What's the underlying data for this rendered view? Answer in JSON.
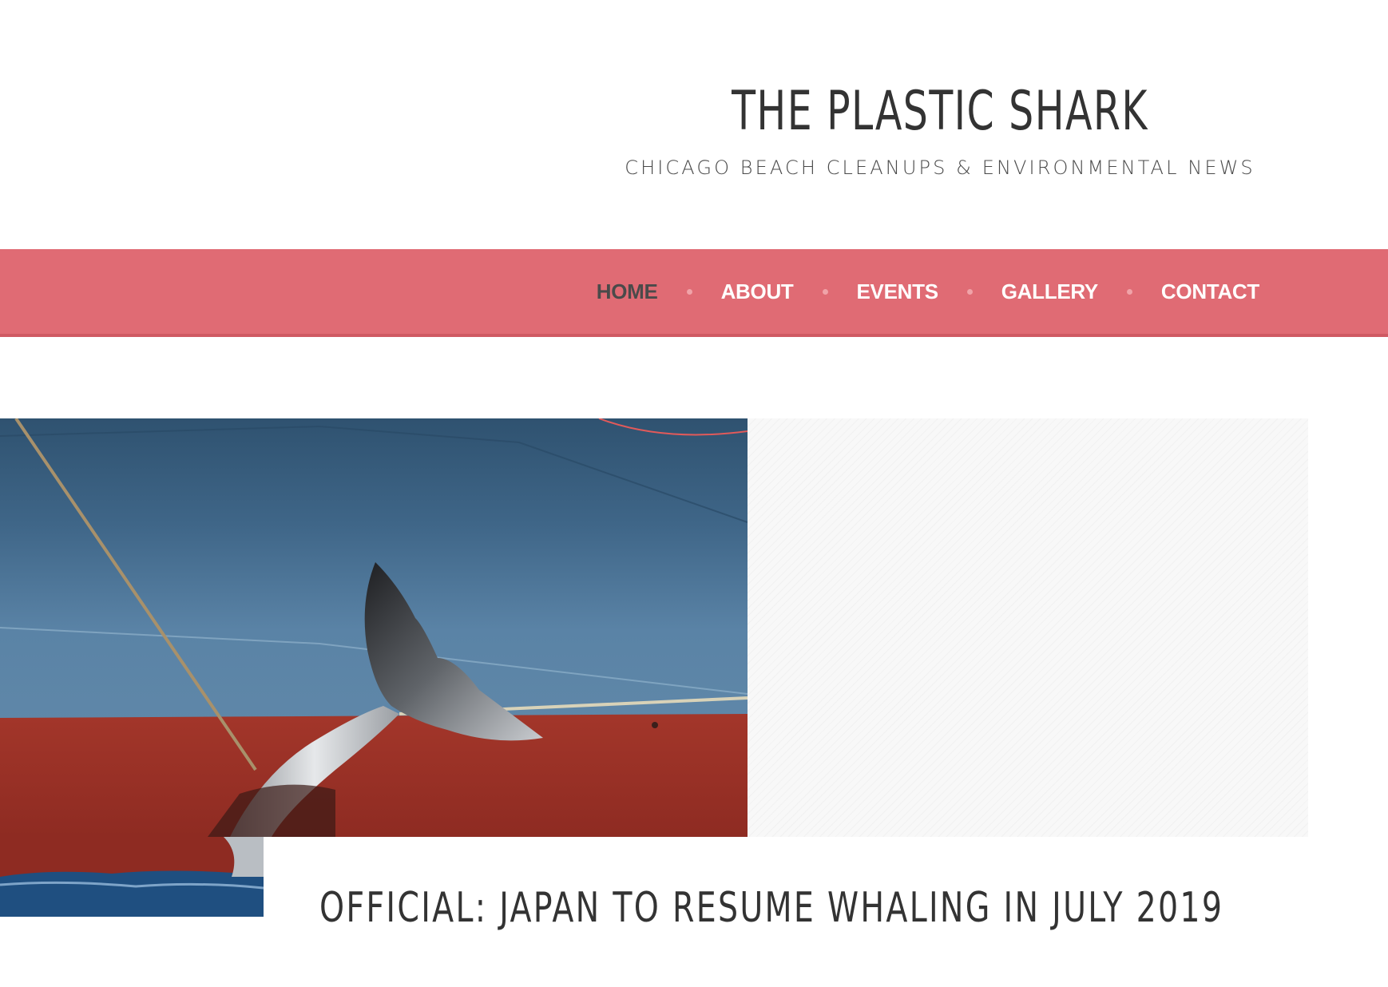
{
  "site": {
    "title": "THE PLASTIC SHARK",
    "tagline": "CHICAGO BEACH CLEANUPS & ENVIRONMENTAL NEWS"
  },
  "nav": {
    "items": [
      {
        "label": "HOME",
        "active": true
      },
      {
        "label": "ABOUT",
        "active": false
      },
      {
        "label": "EVENTS",
        "active": false
      },
      {
        "label": "GALLERY",
        "active": false
      },
      {
        "label": "CONTACT",
        "active": false
      }
    ]
  },
  "featured_post": {
    "title": "OFFICIAL: JAPAN TO RESUME WHALING IN JULY 2019"
  },
  "colors": {
    "nav_background": "#e06b74",
    "nav_active": "#4a4a4a",
    "title_text": "#333333"
  }
}
